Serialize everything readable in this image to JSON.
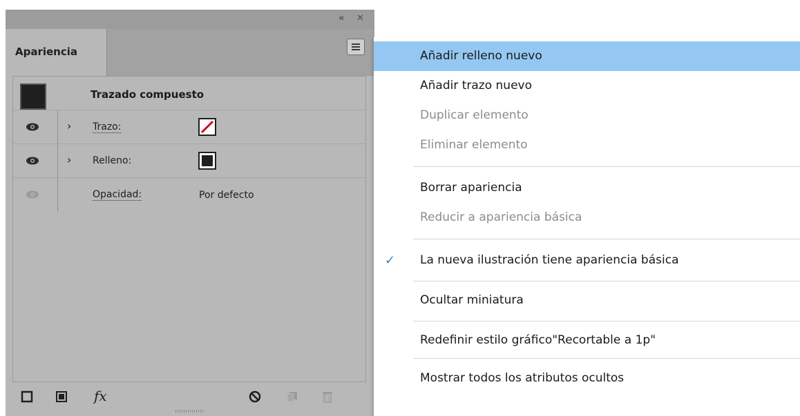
{
  "panel": {
    "tab_label": "Apariencia",
    "collapse_glyph": "«",
    "close_glyph": "✕",
    "object_title": "Trazado compuesto",
    "rows": [
      {
        "label": "Trazo:",
        "value": "",
        "swatch": "stroke-none-red-slash"
      },
      {
        "label": "Relleno:",
        "value": "",
        "swatch": "fill-black"
      },
      {
        "label": "Opacidad:",
        "value": "Por defecto",
        "swatch": ""
      }
    ],
    "footer": {
      "fx_label": "fx"
    }
  },
  "menu": {
    "items": [
      {
        "label": "Añadir relleno nuevo",
        "state": "highlighted"
      },
      {
        "label": "Añadir trazo nuevo",
        "state": "enabled"
      },
      {
        "label": "Duplicar elemento",
        "state": "disabled"
      },
      {
        "label": "Eliminar elemento",
        "state": "disabled"
      },
      {
        "label": "Borrar apariencia",
        "state": "enabled"
      },
      {
        "label": "Reducir a apariencia básica",
        "state": "disabled"
      },
      {
        "label": "La nueva ilustración tiene apariencia básica",
        "state": "checked"
      },
      {
        "label": "Ocultar miniatura",
        "state": "enabled"
      },
      {
        "label": "Redefinir estilo gráfico\"Recortable a 1p\"",
        "state": "enabled"
      },
      {
        "label": "Mostrar todos los atributos ocultos",
        "state": "enabled"
      }
    ],
    "check_glyph": "✓"
  },
  "colors": {
    "highlight": "#94c8f3",
    "panel_bg": "#b8b8b8",
    "stroke_slash": "#d0021b",
    "check": "#2f7fc1"
  }
}
